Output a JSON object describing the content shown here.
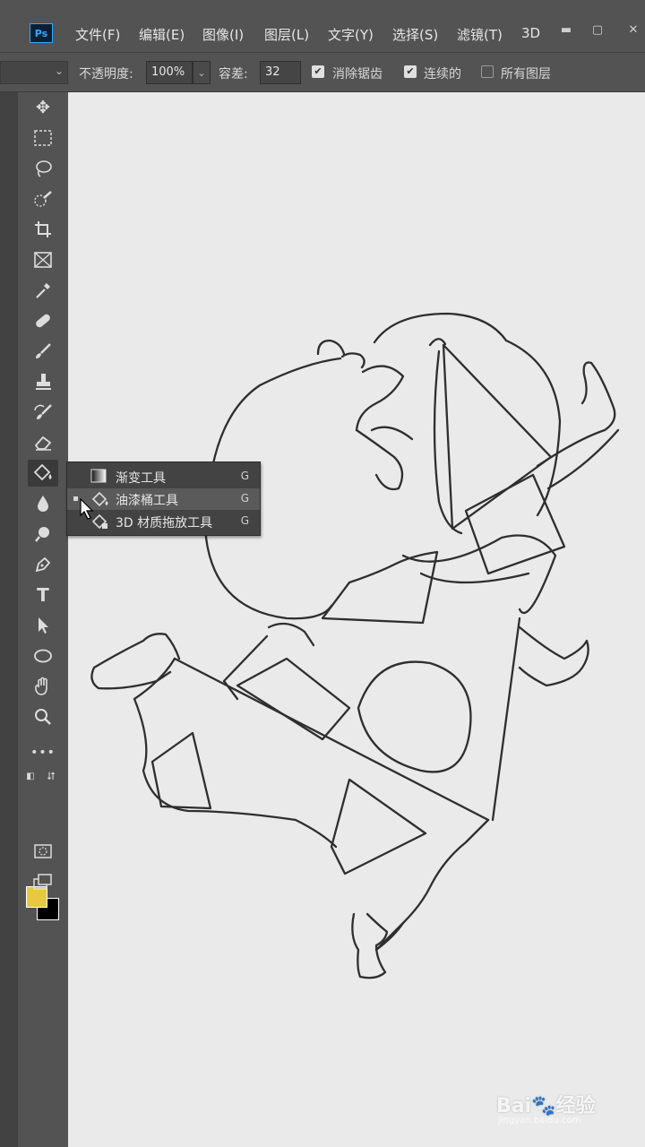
{
  "app": {
    "logo": "Ps"
  },
  "menu": [
    "文件(F)",
    "编辑(E)",
    "图像(I)",
    "图层(L)",
    "文字(Y)",
    "选择(S)",
    "滤镜(T)",
    "3D"
  ],
  "options": {
    "opacity_label": "不透明度:",
    "opacity_value": "100%",
    "tolerance_label": "容差:",
    "tolerance_value": "32",
    "antialias_label": "消除锯齿",
    "antialias_checked": true,
    "contiguous_label": "连续的",
    "contiguous_checked": true,
    "all_layers_label": "所有图层",
    "all_layers_checked": false
  },
  "tools": [
    "move-icon",
    "marquee-icon",
    "lasso-icon",
    "quick-select-icon",
    "crop-icon",
    "frame-icon",
    "eyedropper-icon",
    "healing-icon",
    "brush-icon",
    "stamp-icon",
    "history-brush-icon",
    "eraser-icon",
    "paint-bucket-icon",
    "blur-icon",
    "dodge-icon",
    "pen-icon",
    "type-icon",
    "path-select-icon",
    "ellipse-icon",
    "hand-icon",
    "zoom-icon",
    "more-icon"
  ],
  "flyout": [
    {
      "label": "渐变工具",
      "key": "G",
      "selected": false,
      "icon": "gradient-icon"
    },
    {
      "label": "油漆桶工具",
      "key": "G",
      "selected": true,
      "icon": "paint-bucket-icon"
    },
    {
      "label": "3D 材质拖放工具",
      "key": "G",
      "selected": false,
      "icon": "3d-material-drop-icon"
    }
  ],
  "colors": {
    "foreground": "#e8c840",
    "background": "#000000",
    "canvas": "#eaeaea",
    "accent": "#31a8ff"
  },
  "watermark": {
    "brand": "Bai",
    "brand_cn": "经验",
    "paw": "🐾",
    "url": "jingyan.baidu.com"
  }
}
